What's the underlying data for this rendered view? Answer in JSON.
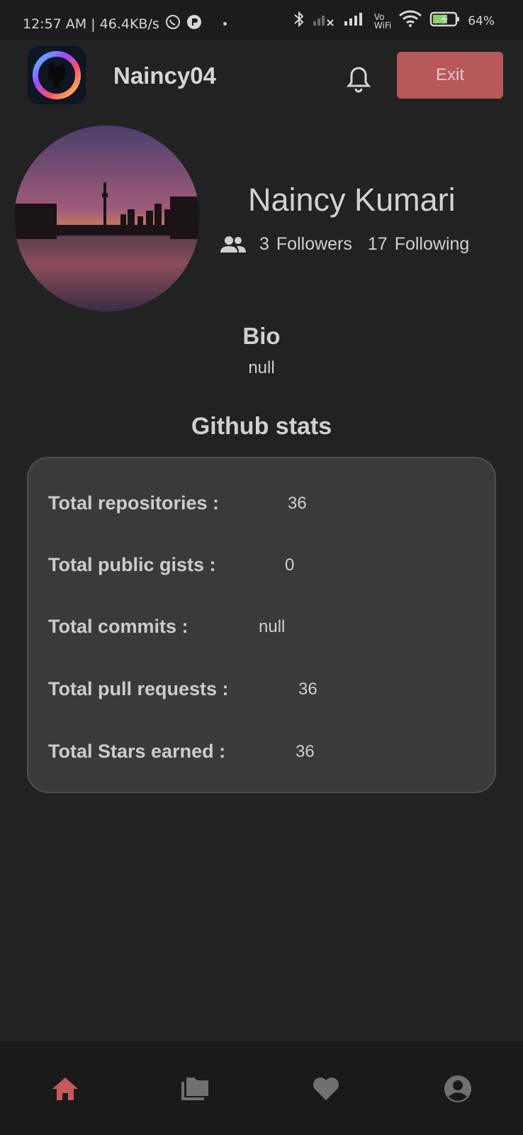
{
  "status_bar": {
    "time_speed": "12:57 AM | 46.4KB/s",
    "vo_wifi_label": "Vo\nWiFi",
    "battery": "64%"
  },
  "app_bar": {
    "username": "Naincy04",
    "exit_label": "Exit"
  },
  "profile": {
    "name": "Naincy Kumari",
    "followers_count": "3",
    "followers_label": "Followers",
    "following_count": "17",
    "following_label": "Following"
  },
  "bio": {
    "title": "Bio",
    "value": "null"
  },
  "stats": {
    "title": "Github stats",
    "rows": [
      {
        "label": "Total repositories  :",
        "value": "36"
      },
      {
        "label": "Total public gists  :",
        "value": "0"
      },
      {
        "label": "Total commits  :",
        "value": "null"
      },
      {
        "label": "Total pull requests  :",
        "value": "36"
      },
      {
        "label": "Total Stars earned  :",
        "value": "36"
      }
    ]
  },
  "bottom_nav": {
    "items": [
      {
        "icon": "home-icon",
        "active": true
      },
      {
        "icon": "folder-icon",
        "active": false
      },
      {
        "icon": "heart-icon",
        "active": false
      },
      {
        "icon": "account-icon",
        "active": false
      }
    ]
  },
  "colors": {
    "background": "#222222",
    "accent": "#b8585b",
    "card": "#3a3a3a"
  }
}
